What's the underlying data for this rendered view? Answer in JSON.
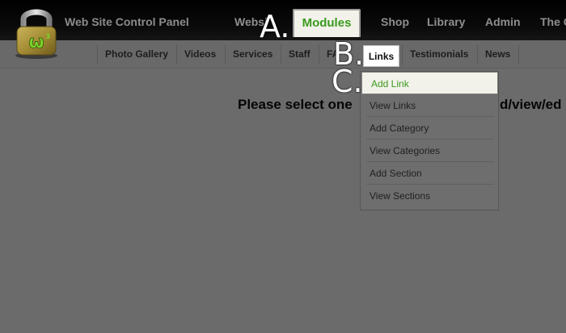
{
  "header": {
    "app_title": "Web Site Control Panel"
  },
  "main_nav": {
    "items": [
      "Websi",
      "Modules",
      "Shop",
      "Library",
      "Admin",
      "The C"
    ],
    "active_index": 1
  },
  "sub_nav": {
    "items": [
      "Photo Gallery",
      "Videos",
      "Services",
      "Staff",
      "FA",
      "Links",
      "Testimonials",
      "News"
    ],
    "active_index": 5
  },
  "content": {
    "message_left": "Please select one",
    "message_right": "d/view/ed"
  },
  "dropdown": {
    "items": [
      "Add Link",
      "View Links",
      "Add Category",
      "View Categories",
      "Add Section",
      "View Sections"
    ],
    "highlighted_index": 0
  },
  "annotations": [
    "A.",
    "B.",
    "C."
  ],
  "colors": {
    "active_green": "#3a9a1e",
    "background": "#6b6b6b",
    "topbar": "#000000"
  },
  "icons": {
    "logo": "padlock-logo-icon"
  }
}
